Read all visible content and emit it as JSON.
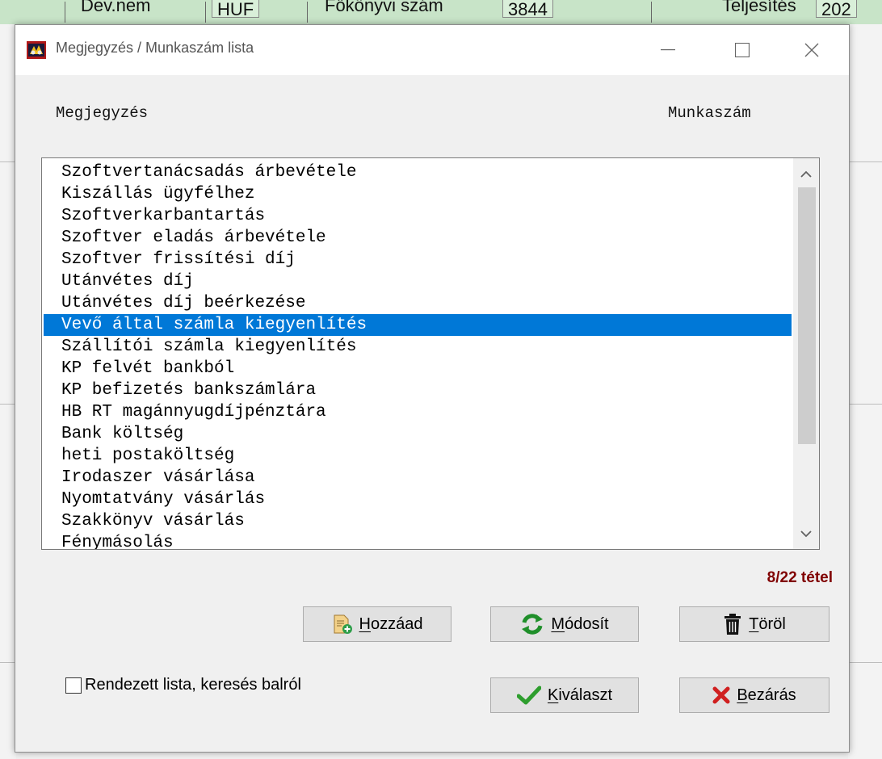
{
  "background_app": {
    "cells": [
      "Dev.nem",
      "HUF",
      "Főkönyvi szám",
      "3844",
      "Teljesítés",
      "202"
    ]
  },
  "dialog": {
    "title": "Megjegyzés / Munkaszám lista",
    "column_headers": {
      "left": "Megjegyzés",
      "right": "Munkaszám"
    },
    "list_items": [
      "Szoftvertanácsadás árbevétele",
      "Kiszállás ügyfélhez",
      "Szoftverkarbantartás",
      "Szoftver eladás árbevétele",
      "Szoftver frissítési díj",
      "Utánvétes díj",
      "Utánvétes díj beérkezése",
      "Vevő által számla kiegyenlítés",
      "Szállítói számla kiegyenlítés",
      "KP felvét bankból",
      "KP befizetés bankszámlára",
      "HB RT magánnyugdíjpénztára",
      "Bank költség",
      "heti postaköltség",
      "Irodaszer vásárlása",
      "Nyomtatvány vásárlás",
      "Szakkönyv vásárlás",
      "Fénymásolás"
    ],
    "selected_index": 7,
    "count_text": "8/22 tétel",
    "buttons": {
      "add": {
        "ul": "H",
        "rest": "ozzáad"
      },
      "modify": {
        "ul": "M",
        "rest": "ódosít"
      },
      "delete": {
        "ul": "T",
        "rest": "öröl"
      },
      "select": {
        "ul": "K",
        "rest": "iválaszt"
      },
      "close": {
        "ul": "B",
        "rest": "ezárás"
      }
    },
    "sorted_checkbox": {
      "label": "Rendezett lista, keresés balról",
      "checked": false
    }
  },
  "colors": {
    "selection": "#0078d7",
    "count_text": "#800000",
    "check_green": "#2e9e2e",
    "close_red": "#d02020"
  }
}
